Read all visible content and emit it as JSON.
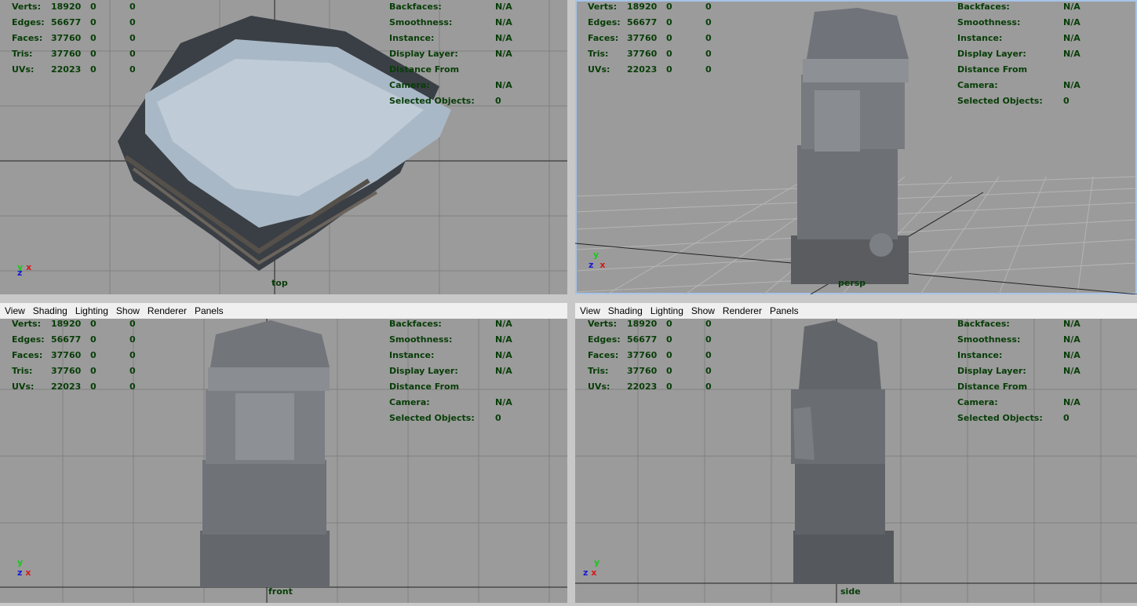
{
  "menu": [
    "View",
    "Shading",
    "Lighting",
    "Show",
    "Renderer",
    "Panels"
  ],
  "hud_left": {
    "rows": [
      {
        "label": "Verts:",
        "v1": "18920",
        "v2": "0",
        "v3": "0"
      },
      {
        "label": "Edges:",
        "v1": "56677",
        "v2": "0",
        "v3": "0"
      },
      {
        "label": "Faces:",
        "v1": "37760",
        "v2": "0",
        "v3": "0"
      },
      {
        "label": "Tris:",
        "v1": "37760",
        "v2": "0",
        "v3": "0"
      },
      {
        "label": "UVs:",
        "v1": "22023",
        "v2": "0",
        "v3": "0"
      }
    ]
  },
  "hud_right": {
    "rows": [
      {
        "label": "Backfaces:",
        "value": "N/A"
      },
      {
        "label": "Smoothness:",
        "value": "N/A"
      },
      {
        "label": "Instance:",
        "value": "N/A"
      },
      {
        "label": "Display Layer:",
        "value": "N/A"
      },
      {
        "label": "Distance From Camera:",
        "value": "N/A"
      },
      {
        "label": "Selected Objects:",
        "value": "0"
      }
    ]
  },
  "viewports": {
    "top": {
      "camera": "top"
    },
    "persp": {
      "camera": "persp"
    },
    "front": {
      "camera": "front"
    },
    "side": {
      "camera": "side"
    }
  },
  "colors": {
    "hud_text": "#073d07",
    "viewport_bg": "#9b9b9b",
    "axis_x": "#d81818",
    "axis_y": "#18c818",
    "axis_z": "#1818d8"
  }
}
